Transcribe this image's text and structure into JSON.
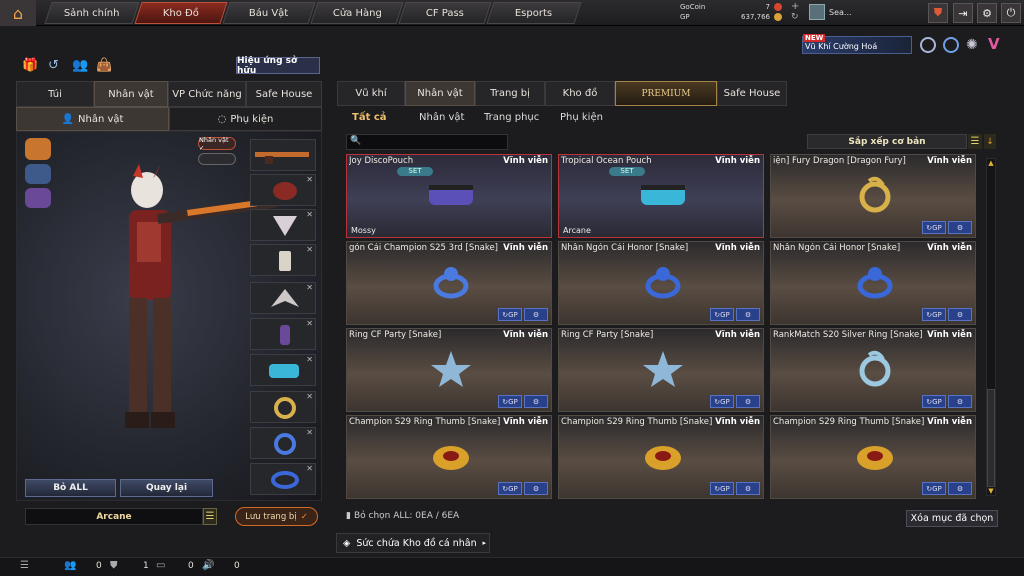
{
  "topnav": {
    "tabs": [
      {
        "label": "Sảnh chính"
      },
      {
        "label": "Kho Đồ"
      },
      {
        "label": "Báu Vật"
      },
      {
        "label": "Cửa Hàng"
      },
      {
        "label": "CF Pass"
      },
      {
        "label": "Esports"
      }
    ],
    "active_index": 1
  },
  "currency": {
    "gocoin_label": "GoCoin",
    "gocoin_value": "7",
    "gp_label": "GP",
    "gp_value": "637,766",
    "player_name": "Sea..."
  },
  "promo": {
    "badge": "NEW",
    "title": "Vũ Khí Cường Hoá"
  },
  "left": {
    "ownership_button": "Hiệu ứng sở hữu",
    "tabs": [
      "Túi",
      "Nhân vật",
      "VP Chức năng",
      "Safe House"
    ],
    "subtabs": [
      "Nhân vật",
      "Phụ kiện"
    ],
    "badge": "Nhân vật ✓",
    "remove_all": "Bỏ ALL",
    "back": "Quay lại",
    "character_name": "Arcane",
    "save_button": "Lưu trang bị"
  },
  "right": {
    "tabs": [
      "Vũ khí",
      "Nhân vật",
      "Trang bị",
      "Kho đồ",
      "PREMIUM",
      "Safe House"
    ],
    "subtabs": [
      "Tất cả",
      "Nhân vật",
      "Trang phục",
      "Phụ kiện"
    ],
    "sort_label": "Sắp xếp cơ bản",
    "search_placeholder": "",
    "items": [
      {
        "name": "Joy DiscoPouch",
        "perm": "Vĩnh viễn",
        "set": "SET",
        "tag": "Mossy",
        "sel": true,
        "icon": "pouch-icon",
        "color": "#5b4fb8"
      },
      {
        "name": "Tropical Ocean Pouch",
        "perm": "Vĩnh viễn",
        "set": "SET",
        "tag": "Arcane",
        "sel": true,
        "icon": "pouch-icon",
        "color": "#3ab6d8"
      },
      {
        "name": "iện] Fury Dragon [Dragon Fury]",
        "perm": "Vĩnh viễn",
        "set": "",
        "tag": "",
        "sel": false,
        "icon": "dragon-ring-icon",
        "color": "#d9b14a"
      },
      {
        "name": "gón Cái Champion S25 3rd [Snake]",
        "perm": "Vĩnh viễn",
        "set": "",
        "tag": "",
        "sel": false,
        "icon": "ring-icon",
        "color": "#4a7ae0"
      },
      {
        "name": "Nhẫn Ngón Cái Honor [Snake]",
        "perm": "Vĩnh viễn",
        "set": "",
        "tag": "",
        "sel": false,
        "icon": "ring-icon",
        "color": "#3a68d8"
      },
      {
        "name": "Nhẫn Ngón Cái Honor [Snake]",
        "perm": "Vĩnh viễn",
        "set": "",
        "tag": "",
        "sel": false,
        "icon": "ring-icon",
        "color": "#3a68d8"
      },
      {
        "name": "Ring CF Party [Snake]",
        "perm": "Vĩnh viễn",
        "set": "",
        "tag": "",
        "sel": false,
        "icon": "star-ring-icon",
        "color": "#8fb8d8"
      },
      {
        "name": "Ring CF Party [Snake]",
        "perm": "Vĩnh viễn",
        "set": "",
        "tag": "",
        "sel": false,
        "icon": "star-ring-icon",
        "color": "#8fb8d8"
      },
      {
        "name": "RankMatch S20 Silver Ring [Snake]",
        "perm": "Vĩnh viễn",
        "set": "",
        "tag": "",
        "sel": false,
        "icon": "dragon-ring-icon",
        "color": "#9cc8e0"
      },
      {
        "name": "Champion S29 Ring Thumb [Snake]",
        "perm": "Vĩnh viễn",
        "set": "",
        "tag": "",
        "sel": false,
        "icon": "gold-ring-icon",
        "color": "#d9a12a"
      },
      {
        "name": "Champion S29 Ring Thumb [Snake]",
        "perm": "Vĩnh viễn",
        "set": "",
        "tag": "",
        "sel": false,
        "icon": "gold-ring-icon",
        "color": "#d9a12a"
      },
      {
        "name": "Champion S29 Ring Thumb [Snake]",
        "perm": "Vĩnh viễn",
        "set": "",
        "tag": "",
        "sel": false,
        "icon": "gold-ring-icon",
        "color": "#d9a12a"
      }
    ],
    "item_button_gp": "↻GP",
    "deselect_all": "Bỏ chọn ALL: 0EA / 6EA",
    "clear_selected": "Xóa mục đã chọn",
    "capacity": "Sức chứa Kho đồ cá nhân"
  },
  "bottom": {
    "v1": "0",
    "v2": "1",
    "v3": "0",
    "v4": "0"
  }
}
